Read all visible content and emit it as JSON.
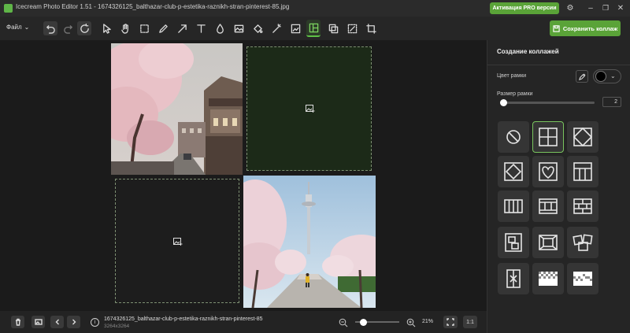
{
  "window": {
    "title": "Icecream Photo Editor 1.51 - 1674326125_balthazar-club-p-estetika-raznikh-stran-pinterest-85.jpg",
    "pro_button": "Активация PRO версии"
  },
  "toolbar": {
    "file_menu": "Файл",
    "file_menu_icon": "chevron-down-icon",
    "tools": [
      "undo-icon",
      "redo-icon",
      "reset-icon",
      "select-icon",
      "hand-icon",
      "crop-select-icon",
      "pencil-icon",
      "arrow-icon",
      "text-icon",
      "blur-icon",
      "image-icon",
      "fill-icon",
      "magic-icon",
      "picture-icon",
      "collage-icon",
      "copy-icon",
      "transform-icon",
      "crop-icon"
    ],
    "active_tool": "collage-icon",
    "save_label": "Сохранить коллаж"
  },
  "panel": {
    "title": "Создание коллажей",
    "frame_color_label": "Цвет рамки",
    "frame_color": "#000000",
    "frame_size_label": "Размер рамки",
    "frame_size": "2",
    "layouts": [
      "none",
      "grid-2x2",
      "diamond",
      "octagon-frame",
      "heart",
      "grid-3col-header",
      "vertical-stripes",
      "film-strip",
      "brick",
      "scattered",
      "center-frame",
      "polaroid",
      "x-pieces",
      "transparent-checker",
      "checker-wave"
    ],
    "selected_layout": "grid-2x2"
  },
  "status": {
    "filename": "1674326125_balthazar-club-p-estetika-raznikh-stran-pinterest-85",
    "dimensions": "3264x3264",
    "zoom": "21%",
    "one_to_one": "1:1"
  },
  "colors": {
    "accent": "#5aa338",
    "bg": "#1e1e1e",
    "panel": "#252525"
  }
}
